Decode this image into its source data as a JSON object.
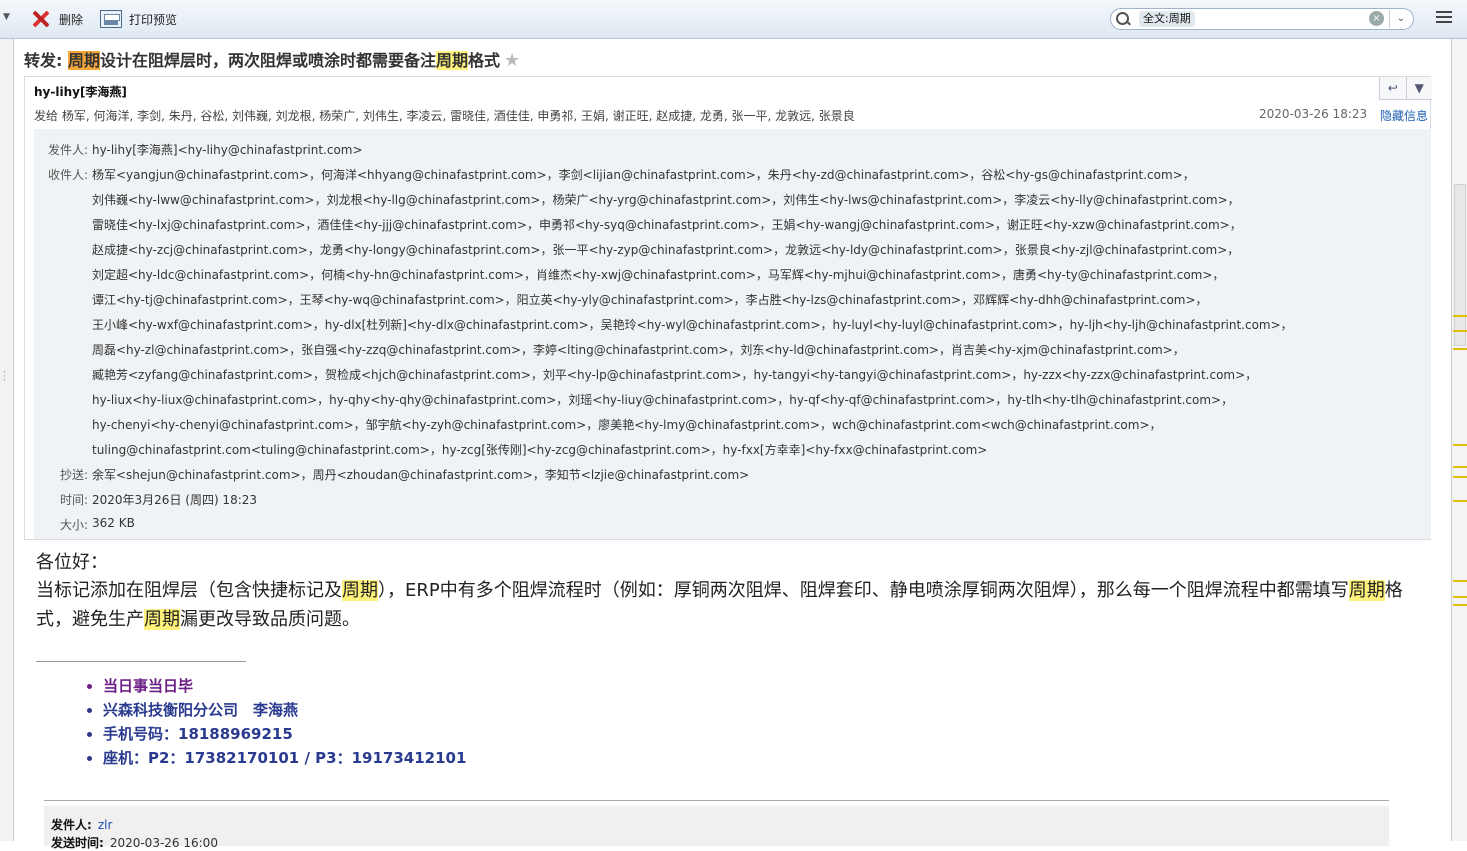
{
  "toolbar": {
    "delete_label": "删除",
    "print_preview_label": "打印预览",
    "search_chip": "全文:周期",
    "search_clear": "×",
    "search_dropdown": "⌄"
  },
  "subject": {
    "prefix": "转发: ",
    "hl1": "周期",
    "mid": "设计在阻焊层时，两次阻焊或喷涂时都需要备注",
    "hl2": "周期",
    "suffix": "格式",
    "star": "★"
  },
  "header": {
    "sender_display": "hy-lihy[李海燕]",
    "sent_to_line": "发给 杨军, 何海洋, 李剑, 朱丹, 谷松, 刘伟巍, 刘龙根, 杨荣广, 刘伟生, 李凌云, 雷晓佳, 酒佳佳, 申勇祁, 王娟, 谢正旺, 赵成捷, 龙勇, 张一平, 龙敦远, 张景良",
    "date": "2020-03-26 18:23",
    "hide_info": "隐藏信息",
    "reply_icon": "↩",
    "more_icon": "▼"
  },
  "details": {
    "from_label": "发件人:",
    "from_value": "hy-lihy[李海燕]<hy-lihy@chinafastprint.com>",
    "to_label": "收件人:",
    "to_lines": [
      "杨军<yangjun@chinafastprint.com>，何海洋<hhyang@chinafastprint.com>，李剑<lijian@chinafastprint.com>，朱丹<hy-zd@chinafastprint.com>，谷松<hy-gs@chinafastprint.com>，",
      "刘伟巍<hy-lww@chinafastprint.com>，刘龙根<hy-llg@chinafastprint.com>，杨荣广<hy-yrg@chinafastprint.com>，刘伟生<hy-lws@chinafastprint.com>，李凌云<hy-lly@chinafastprint.com>，",
      "雷晓佳<hy-lxj@chinafastprint.com>，酒佳佳<hy-jjj@chinafastprint.com>，申勇祁<hy-syq@chinafastprint.com>，王娟<hy-wangj@chinafastprint.com>，谢正旺<hy-xzw@chinafastprint.com>，",
      "赵成捷<hy-zcj@chinafastprint.com>，龙勇<hy-longy@chinafastprint.com>，张一平<hy-zyp@chinafastprint.com>，龙敦远<hy-ldy@chinafastprint.com>，张景良<hy-zjl@chinafastprint.com>，",
      "刘定超<hy-ldc@chinafastprint.com>，何楠<hy-hn@chinafastprint.com>，肖维杰<hy-xwj@chinafastprint.com>，马军辉<hy-mjhui@chinafastprint.com>，唐勇<hy-ty@chinafastprint.com>，",
      "谭江<hy-tj@chinafastprint.com>，王琴<hy-wq@chinafastprint.com>，阳立英<hy-yly@chinafastprint.com>，李占胜<hy-lzs@chinafastprint.com>，邓辉辉<hy-dhh@chinafastprint.com>，",
      "王小峰<hy-wxf@chinafastprint.com>，hy-dlx[杜列新]<hy-dlx@chinafastprint.com>，吴艳玲<hy-wyl@chinafastprint.com>，hy-luyl<hy-luyl@chinafastprint.com>，hy-ljh<hy-ljh@chinafastprint.com>，",
      "周磊<hy-zl@chinafastprint.com>，张自强<hy-zzq@chinafastprint.com>，李婷<lting@chinafastprint.com>，刘东<hy-ld@chinafastprint.com>，肖吉美<hy-xjm@chinafastprint.com>，",
      "臧艳芳<zyfang@chinafastprint.com>，贺检成<hjch@chinafastprint.com>，刘平<hy-lp@chinafastprint.com>，hy-tangyi<hy-tangyi@chinafastprint.com>，hy-zzx<hy-zzx@chinafastprint.com>，",
      "hy-liux<hy-liux@chinafastprint.com>，hy-qhy<hy-qhy@chinafastprint.com>，刘瑶<hy-liuy@chinafastprint.com>，hy-qf<hy-qf@chinafastprint.com>，hy-tlh<hy-tlh@chinafastprint.com>，",
      "hy-chenyi<hy-chenyi@chinafastprint.com>，邹宇航<hy-zyh@chinafastprint.com>，廖美艳<hy-lmy@chinafastprint.com>，wch@chinafastprint.com<wch@chinafastprint.com>，",
      "tuling@chinafastprint.com<tuling@chinafastprint.com>，hy-zcg[张传刚]<hy-zcg@chinafastprint.com>，hy-fxx[方幸幸]<hy-fxx@chinafastprint.com>"
    ],
    "cc_label": "抄送:",
    "cc_value": "余军<shejun@chinafastprint.com>，周丹<zhoudan@chinafastprint.com>，李知节<lzjie@chinafastprint.com>",
    "time_label": "时间:",
    "time_value": "2020年3月26日 (周四) 18:23",
    "size_label": "大小:",
    "size_value": "362 KB"
  },
  "body": {
    "greeting": "各位好：",
    "p1": "  当标记添加在阻焊层（包含快捷标记及",
    "hl1": "周期",
    "p2": "），ERP中有多个阻焊流程时（例如：厚铜两次阻焊、阻焊套印、静电喷涂厚铜两次阻焊），那么每一个阻焊流程中都需填写",
    "hl2": "周期",
    "p3": "格式，避免生产",
    "hl3": "周期",
    "p4": "漏更改导致品质问题。"
  },
  "signature": [
    "当日事当日毕",
    "兴森科技衡阳分公司　李海燕",
    "手机号码：18188969215",
    "座机：P2：17382170101 / P3：19173412101"
  ],
  "quoted": {
    "from_label": "发件人:",
    "from_value": "zlr",
    "time_label": "发送时间:",
    "time_value": "2020-03-26 16:00"
  },
  "colors": {
    "highlight": "#fff27a",
    "highlight_active": "#f7a73a",
    "link": "#1e5fb0",
    "signature_blue": "#2a3a8f",
    "signature_purple": "#6d1f87"
  }
}
